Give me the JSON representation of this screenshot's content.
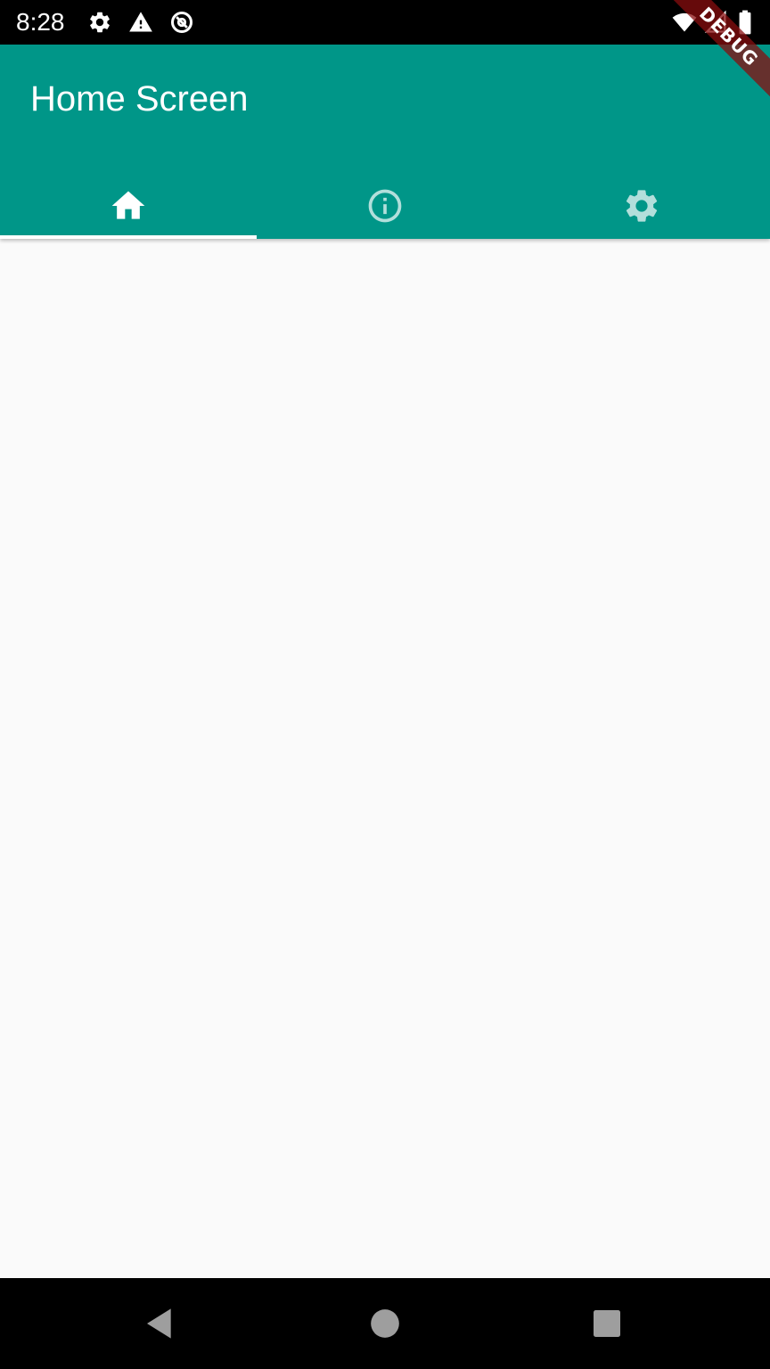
{
  "status_bar": {
    "time": "8:28",
    "left_icons": [
      "settings-icon",
      "warning-icon",
      "data-saver-icon"
    ],
    "right_icons": [
      "wifi-icon",
      "cellular-signal-icon",
      "battery-icon"
    ]
  },
  "debug_banner": {
    "label": "DEBUG"
  },
  "app_bar": {
    "title": "Home Screen",
    "background_color": "#009688"
  },
  "tabs": [
    {
      "icon": "home-icon",
      "selected": true
    },
    {
      "icon": "info-icon",
      "selected": false
    },
    {
      "icon": "settings-icon",
      "selected": false
    }
  ],
  "nav_bar": {
    "buttons": [
      "back-icon",
      "home-circle-icon",
      "recents-icon"
    ]
  },
  "colors": {
    "primary": "#009688",
    "tab_selected": "#ffffff",
    "tab_unselected": "#b2dfdb",
    "background": "#fafafa",
    "system_bar": "#000000"
  }
}
